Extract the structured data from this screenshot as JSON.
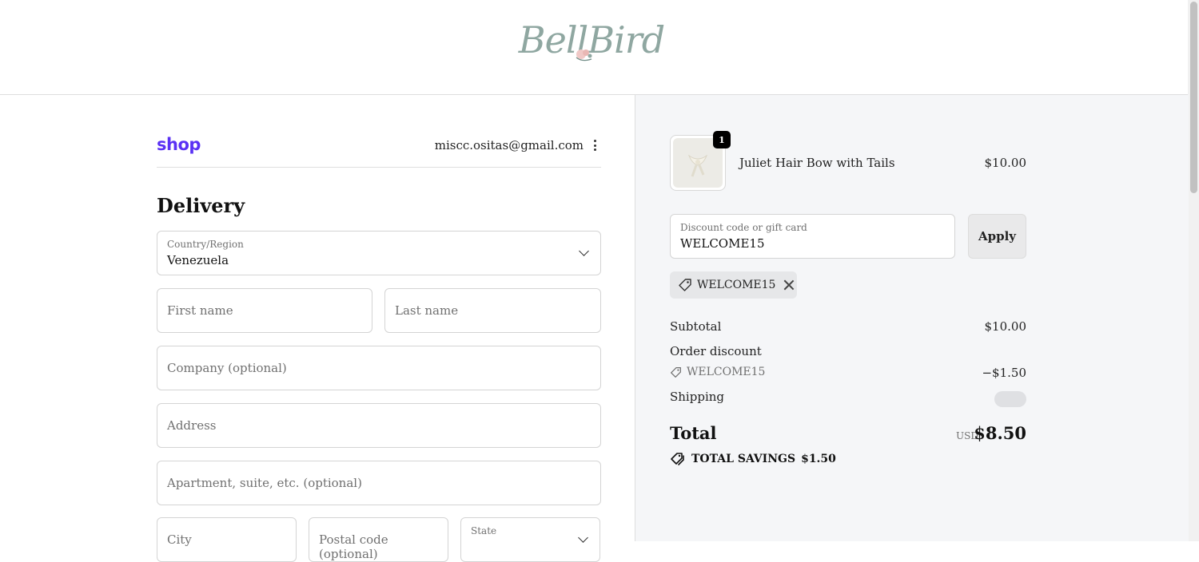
{
  "brand": {
    "logo_text": "BellBird"
  },
  "account": {
    "shop_label": "shop",
    "email": "miscc.ositas@gmail.com"
  },
  "delivery": {
    "title": "Delivery",
    "country": {
      "label": "Country/Region",
      "value": "Venezuela"
    },
    "first_name_placeholder": "First name",
    "last_name_placeholder": "Last name",
    "company_placeholder": "Company (optional)",
    "address_placeholder": "Address",
    "apartment_placeholder": "Apartment, suite, etc. (optional)",
    "city_placeholder": "City",
    "postal_placeholder": "Postal code (optional)",
    "state_label": "State"
  },
  "cart": {
    "item": {
      "quantity": "1",
      "name": "Juliet Hair Bow with Tails",
      "price": "$10.00"
    }
  },
  "discount": {
    "input_label": "Discount code or gift card",
    "input_value": "WELCOME15",
    "apply_label": "Apply",
    "applied_code": "WELCOME15"
  },
  "summary": {
    "subtotal_label": "Subtotal",
    "subtotal_value": "$10.00",
    "order_discount_label": "Order discount",
    "discount_code": "WELCOME15",
    "discount_value": "−$1.50",
    "shipping_label": "Shipping",
    "total_label": "Total",
    "currency": "USD",
    "total_value": "$8.50",
    "savings_label": "TOTAL SAVINGS",
    "savings_value": "$1.50"
  },
  "colors": {
    "shop_brand": "#5a31f4",
    "summary_bg": "#f5f6f8",
    "logo": "#8fa7a1"
  }
}
